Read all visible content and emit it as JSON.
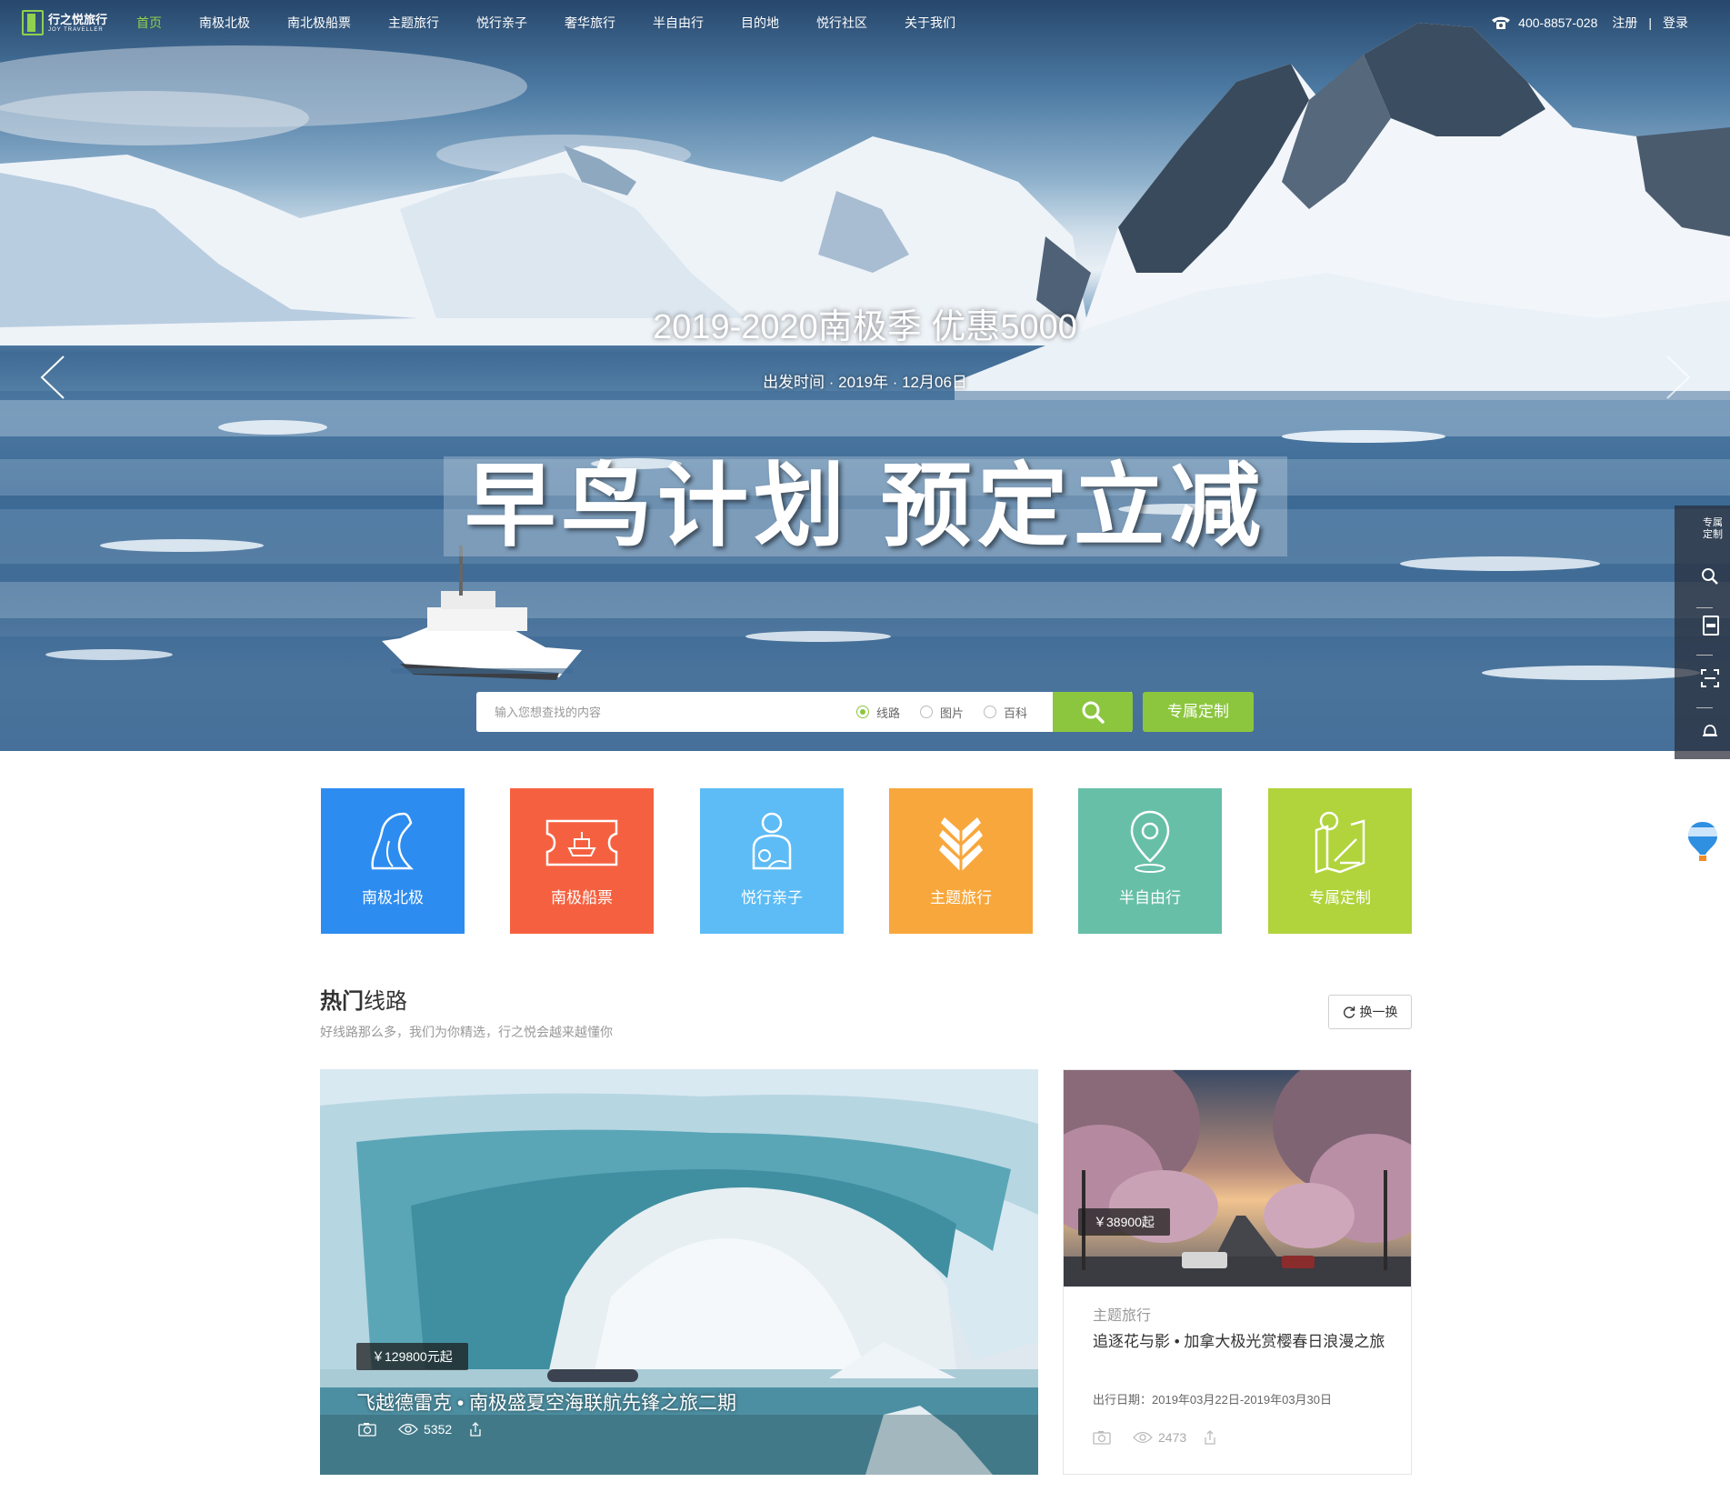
{
  "nav": {
    "logo_cn": "行之悦旅行",
    "logo_en": "JOY TRAVELLER",
    "items": [
      {
        "label": "首页",
        "active": true
      },
      {
        "label": "南极北极",
        "active": false
      },
      {
        "label": "南北极船票",
        "active": false
      },
      {
        "label": "主题旅行",
        "active": false
      },
      {
        "label": "悦行亲子",
        "active": false
      },
      {
        "label": "奢华旅行",
        "active": false
      },
      {
        "label": "半自由行",
        "active": false
      },
      {
        "label": "目的地",
        "active": false
      },
      {
        "label": "悦行社区",
        "active": false
      },
      {
        "label": "关于我们",
        "active": false
      }
    ],
    "phone": "400-8857-028",
    "register": "注册",
    "separator": "|",
    "login": "登录",
    "accent_color": "#8fd14f"
  },
  "hero": {
    "title": "2019-2020南极季 优惠5000",
    "date_text": "出发时间 · 2019年 · 12月06日",
    "slogan": "早鸟计划  预定立减",
    "prev_icon": "chevron-left-icon",
    "next_icon": "chevron-right-icon"
  },
  "search": {
    "placeholder": "输入您想查找的内容",
    "options": [
      {
        "label": "线路",
        "checked": true
      },
      {
        "label": "图片",
        "checked": false
      },
      {
        "label": "百科",
        "checked": false
      }
    ],
    "button_icon": "search-icon",
    "custom_label": "专属定制",
    "color": "#8cc63f"
  },
  "side_tools": {
    "top_label_1": "专属",
    "top_label_2": "定制",
    "icons": [
      "search-icon",
      "save-icon",
      "scan-icon",
      "bell-icon"
    ]
  },
  "categories": [
    {
      "label": "南极北极",
      "color": "#2d8cf0",
      "icon": "penguin-icon"
    },
    {
      "label": "南极船票",
      "color": "#f56140",
      "icon": "ticket-icon"
    },
    {
      "label": "悦行亲子",
      "color": "#5dbcf5",
      "icon": "parent-child-icon"
    },
    {
      "label": "主题旅行",
      "color": "#f8a73c",
      "icon": "leaf-icon"
    },
    {
      "label": "半自由行",
      "color": "#67bfa8",
      "icon": "location-pin-icon"
    },
    {
      "label": "专属定制",
      "color": "#b1d33c",
      "icon": "map-icon"
    }
  ],
  "hot_routes": {
    "title_bold": "热门",
    "title_rest": "线路",
    "subtitle": "好线路那么多，我们为你精选，行之悦会越来越懂你",
    "swap_label": "换一换",
    "featured": {
      "price": "￥129800元起",
      "title": "飞越德雷克 • 南极盛夏空海联航先锋之旅二期",
      "views": "5352"
    },
    "side": {
      "price": "￥38900起",
      "category": "主题旅行",
      "title": "追逐花与影 • 加拿大极光赏樱春日浪漫之旅",
      "date": "出行日期：2019年03月22日-2019年03月30日",
      "views": "2473"
    }
  }
}
